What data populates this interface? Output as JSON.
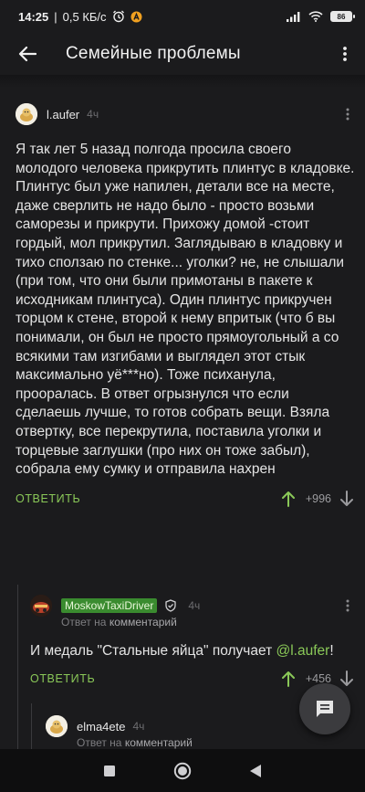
{
  "status_bar": {
    "time": "14:25",
    "speed": "0,5 КБ/с",
    "battery": "86",
    "icons": [
      "alarm-icon",
      "notification-a-icon",
      "signal-icon",
      "wifi-icon",
      "battery-icon"
    ]
  },
  "app_bar": {
    "title": "Семейные проблемы",
    "back_icon": "arrow-back-icon",
    "menu_icon": "more-vertical-icon"
  },
  "comments": [
    {
      "username": "l.aufer",
      "time": "4ч",
      "text": "Я так лет 5 назад полгода просила своего молодого человека прикрутить плинтус в кладовке. Плинтус был уже напилен, детали все на месте, даже сверлить не надо было - просто возьми саморезы и прикрути. Прихожу домой -стоит гордый, мол прикрутил. Заглядываю в кладовку и тихо сползаю по стенке... уголки? не, не слышали (при том, что они были примотаны в пакете к исходникам плинтуса). Один плинтус прикручен торцом к стене, второй к нему впритык (что б вы понимали, он был не просто прямоугольный а со всякими там изгибами и выглядел этот стык максимально уё***но). Тоже психанула, прооралась. В ответ огрызнулся что если сделаешь лучше, то готов собрать вещи. Взяла отвертку, все перекрутила, поставила уголки и торцевые заглушки (про них он тоже забыл), собрала ему сумку и отправила нахрен",
      "reply_label": "ОТВЕТИТЬ",
      "score": "+996"
    },
    {
      "username": "MoskowTaxiDriver",
      "time": "4ч",
      "reply_to_prefix": "Ответ на",
      "reply_to_target": "комментарий",
      "text_before": "И медаль \"Стальные яйца\" получает ",
      "mention": "@l.aufer",
      "text_after": "!",
      "reply_label": "ОТВЕТИТЬ",
      "score": "+456"
    },
    {
      "username": "elma4ete",
      "time": "4ч",
      "reply_to_prefix": "Ответ на",
      "reply_to_target": "комментарий"
    }
  ],
  "colors": {
    "background": "#1b1b1d",
    "accent_green": "#8ac858",
    "badge_green": "#3a8b2f",
    "muted": "#6d6d70"
  }
}
